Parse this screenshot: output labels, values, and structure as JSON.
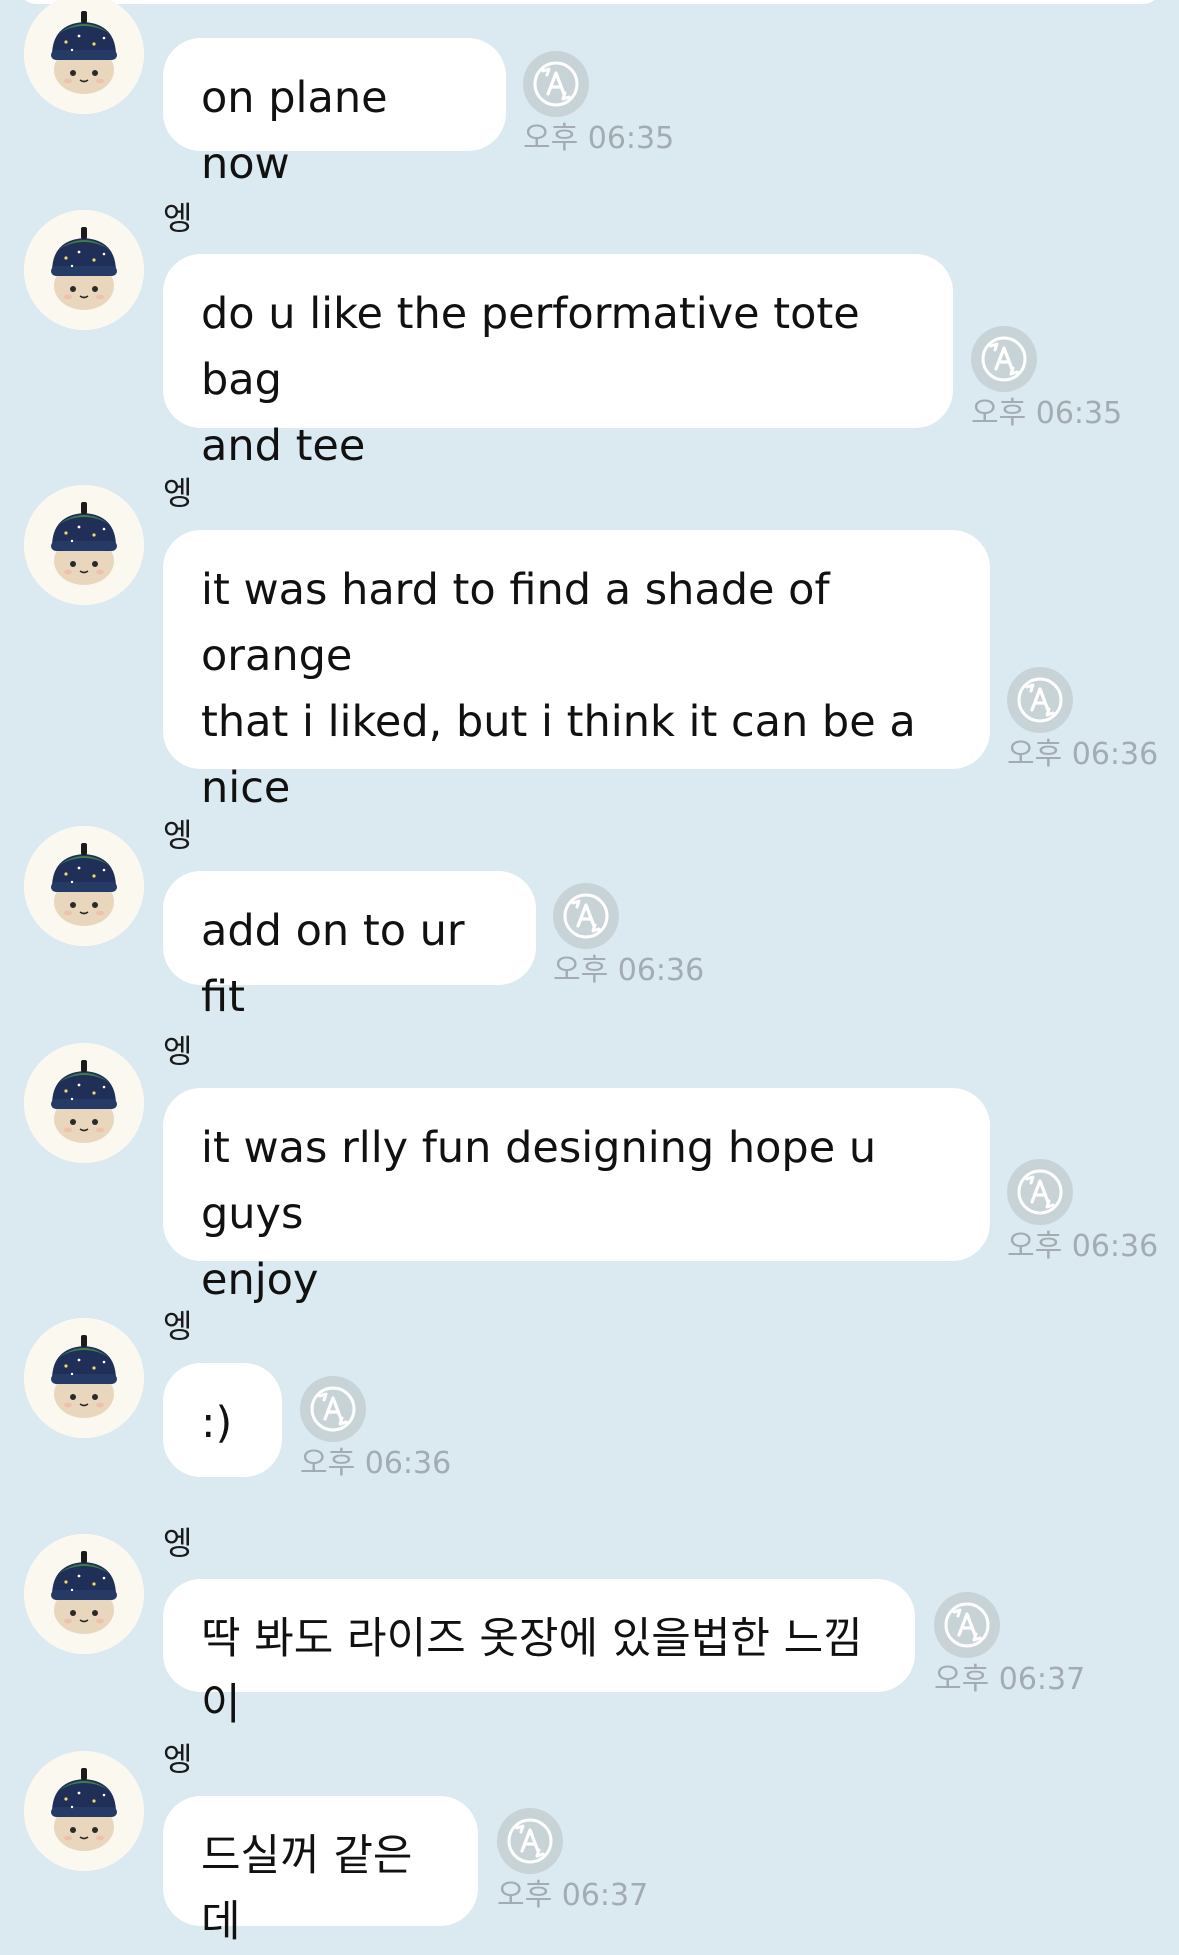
{
  "messages": [
    {
      "sender": "엥",
      "text": "on plane now",
      "time": "오후 06:35"
    },
    {
      "sender": "엥",
      "text": "do u like the performative tote bag\nand tee",
      "time": "오후 06:35"
    },
    {
      "sender": "엥",
      "text": "it was hard to find a shade of orange\nthat i liked, but i think it can be a\nnice",
      "time": "오후 06:36"
    },
    {
      "sender": "엥",
      "text": "add on to ur fit",
      "time": "오후 06:36"
    },
    {
      "sender": "엥",
      "text": "it was rlly fun designing hope u guys\nenjoy",
      "time": "오후 06:36"
    },
    {
      "sender": "엥",
      "text": ":)",
      "time": "오후 06:36"
    },
    {
      "sender": "엥",
      "text": "딱 봐도 라이즈 옷장에 있을법한 느낌이",
      "time": "오후 06:37"
    },
    {
      "sender": "엥",
      "text": "드실꺼 같은데",
      "time": "오후 06:37"
    }
  ],
  "icons": {
    "avatar": "beanie-plush-avatar",
    "translate": "auto-translate-a-icon"
  },
  "colors": {
    "background": "#dbeaf0",
    "bubble": "#ffffff",
    "timestamp": "#a2acb2",
    "translate_icon_bg": "#c8d3d8"
  }
}
